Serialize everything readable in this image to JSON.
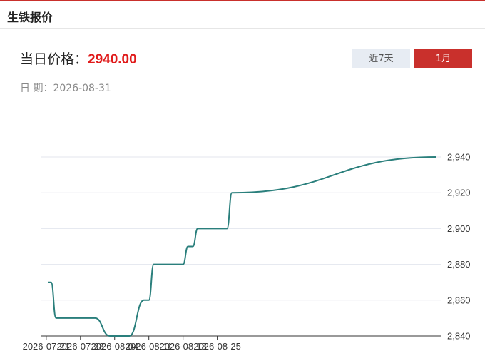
{
  "header": {
    "title": "生铁报价"
  },
  "price": {
    "label": "当日价格：",
    "value": "2940.00"
  },
  "date": {
    "label": "日 期：",
    "value": "2026-08-31"
  },
  "tabs": {
    "week": "近7天",
    "month": "1月"
  },
  "colors": {
    "accent": "#c9302c",
    "line": "#2a7f7c",
    "price": "#e01b1b"
  },
  "chart_data": {
    "type": "line",
    "title": "",
    "xlabel": "",
    "ylabel": "",
    "ylim": [
      2840,
      2940
    ],
    "yticks": [
      2840,
      2860,
      2880,
      2900,
      2920,
      2940
    ],
    "ytick_labels": [
      "2,840",
      "2,860",
      "2,880",
      "2,900",
      "2,920",
      "2,940"
    ],
    "xticks": [
      "2026-07-21",
      "2026-07-28",
      "2026-08-04",
      "2026-08-11",
      "2026-08-18",
      "2026-08-25"
    ],
    "grid": true,
    "legend": "none",
    "x": [
      "2026-07-21",
      "2026-07-22",
      "2026-07-23",
      "2026-07-24",
      "2026-07-27",
      "2026-07-28",
      "2026-07-29",
      "2026-07-30",
      "2026-07-31",
      "2026-08-03",
      "2026-08-04",
      "2026-08-05",
      "2026-08-06",
      "2026-08-07",
      "2026-08-10",
      "2026-08-11",
      "2026-08-12",
      "2026-08-13",
      "2026-08-14",
      "2026-08-17",
      "2026-08-18",
      "2026-08-19",
      "2026-08-20",
      "2026-08-21",
      "2026-08-24",
      "2026-08-25",
      "2026-08-26",
      "2026-08-27",
      "2026-08-28",
      "2026-08-31"
    ],
    "values": [
      2870,
      2870,
      2850,
      2850,
      2850,
      2850,
      2850,
      2850,
      2850,
      2840,
      2840,
      2840,
      2840,
      2840,
      2860,
      2860,
      2880,
      2880,
      2880,
      2880,
      2880,
      2890,
      2890,
      2900,
      2900,
      2900,
      2900,
      2900,
      2920,
      2940
    ]
  }
}
